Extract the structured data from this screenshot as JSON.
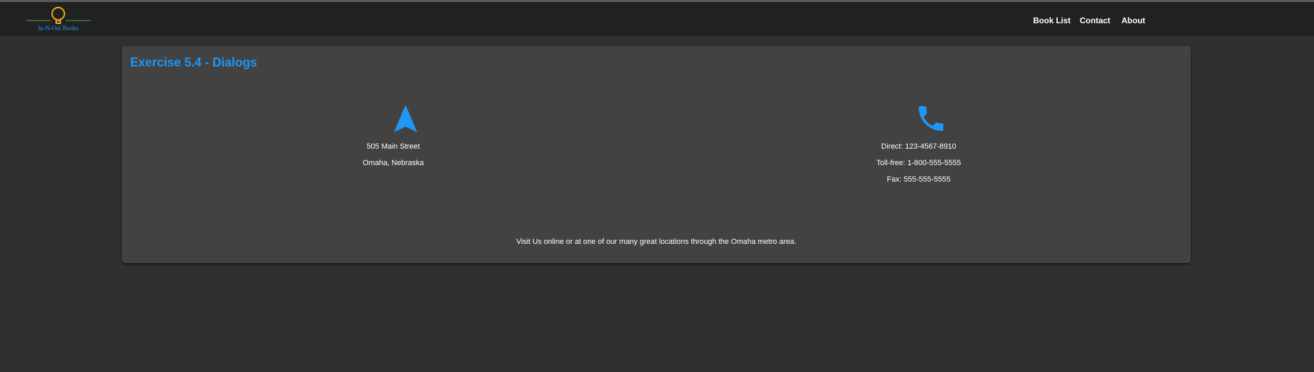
{
  "header": {
    "logo_text": "In-N-Out Books",
    "nav": {
      "book_list": "Book List",
      "contact": "Contact",
      "about": "About"
    }
  },
  "main": {
    "title": "Exercise 5.4 - Dialogs",
    "address": {
      "icon": "navigation-icon",
      "street": "505 Main Street",
      "city": "Omaha, Nebraska"
    },
    "phones": {
      "icon": "phone-icon",
      "direct": "Direct: 123-4567-8910",
      "toll_free": "Toll-free: 1-800-555-5555",
      "fax": "Fax: 555-555-5555"
    },
    "footer_text": "Visit Us online or at one of our many great locations through the Omaha metro area."
  },
  "colors": {
    "accent": "#2196f3",
    "logo_bulb": "#f5a623",
    "logo_line": "#4caf50",
    "toolbar_bg": "#212121",
    "page_bg": "#303030",
    "card_bg": "#424242"
  }
}
